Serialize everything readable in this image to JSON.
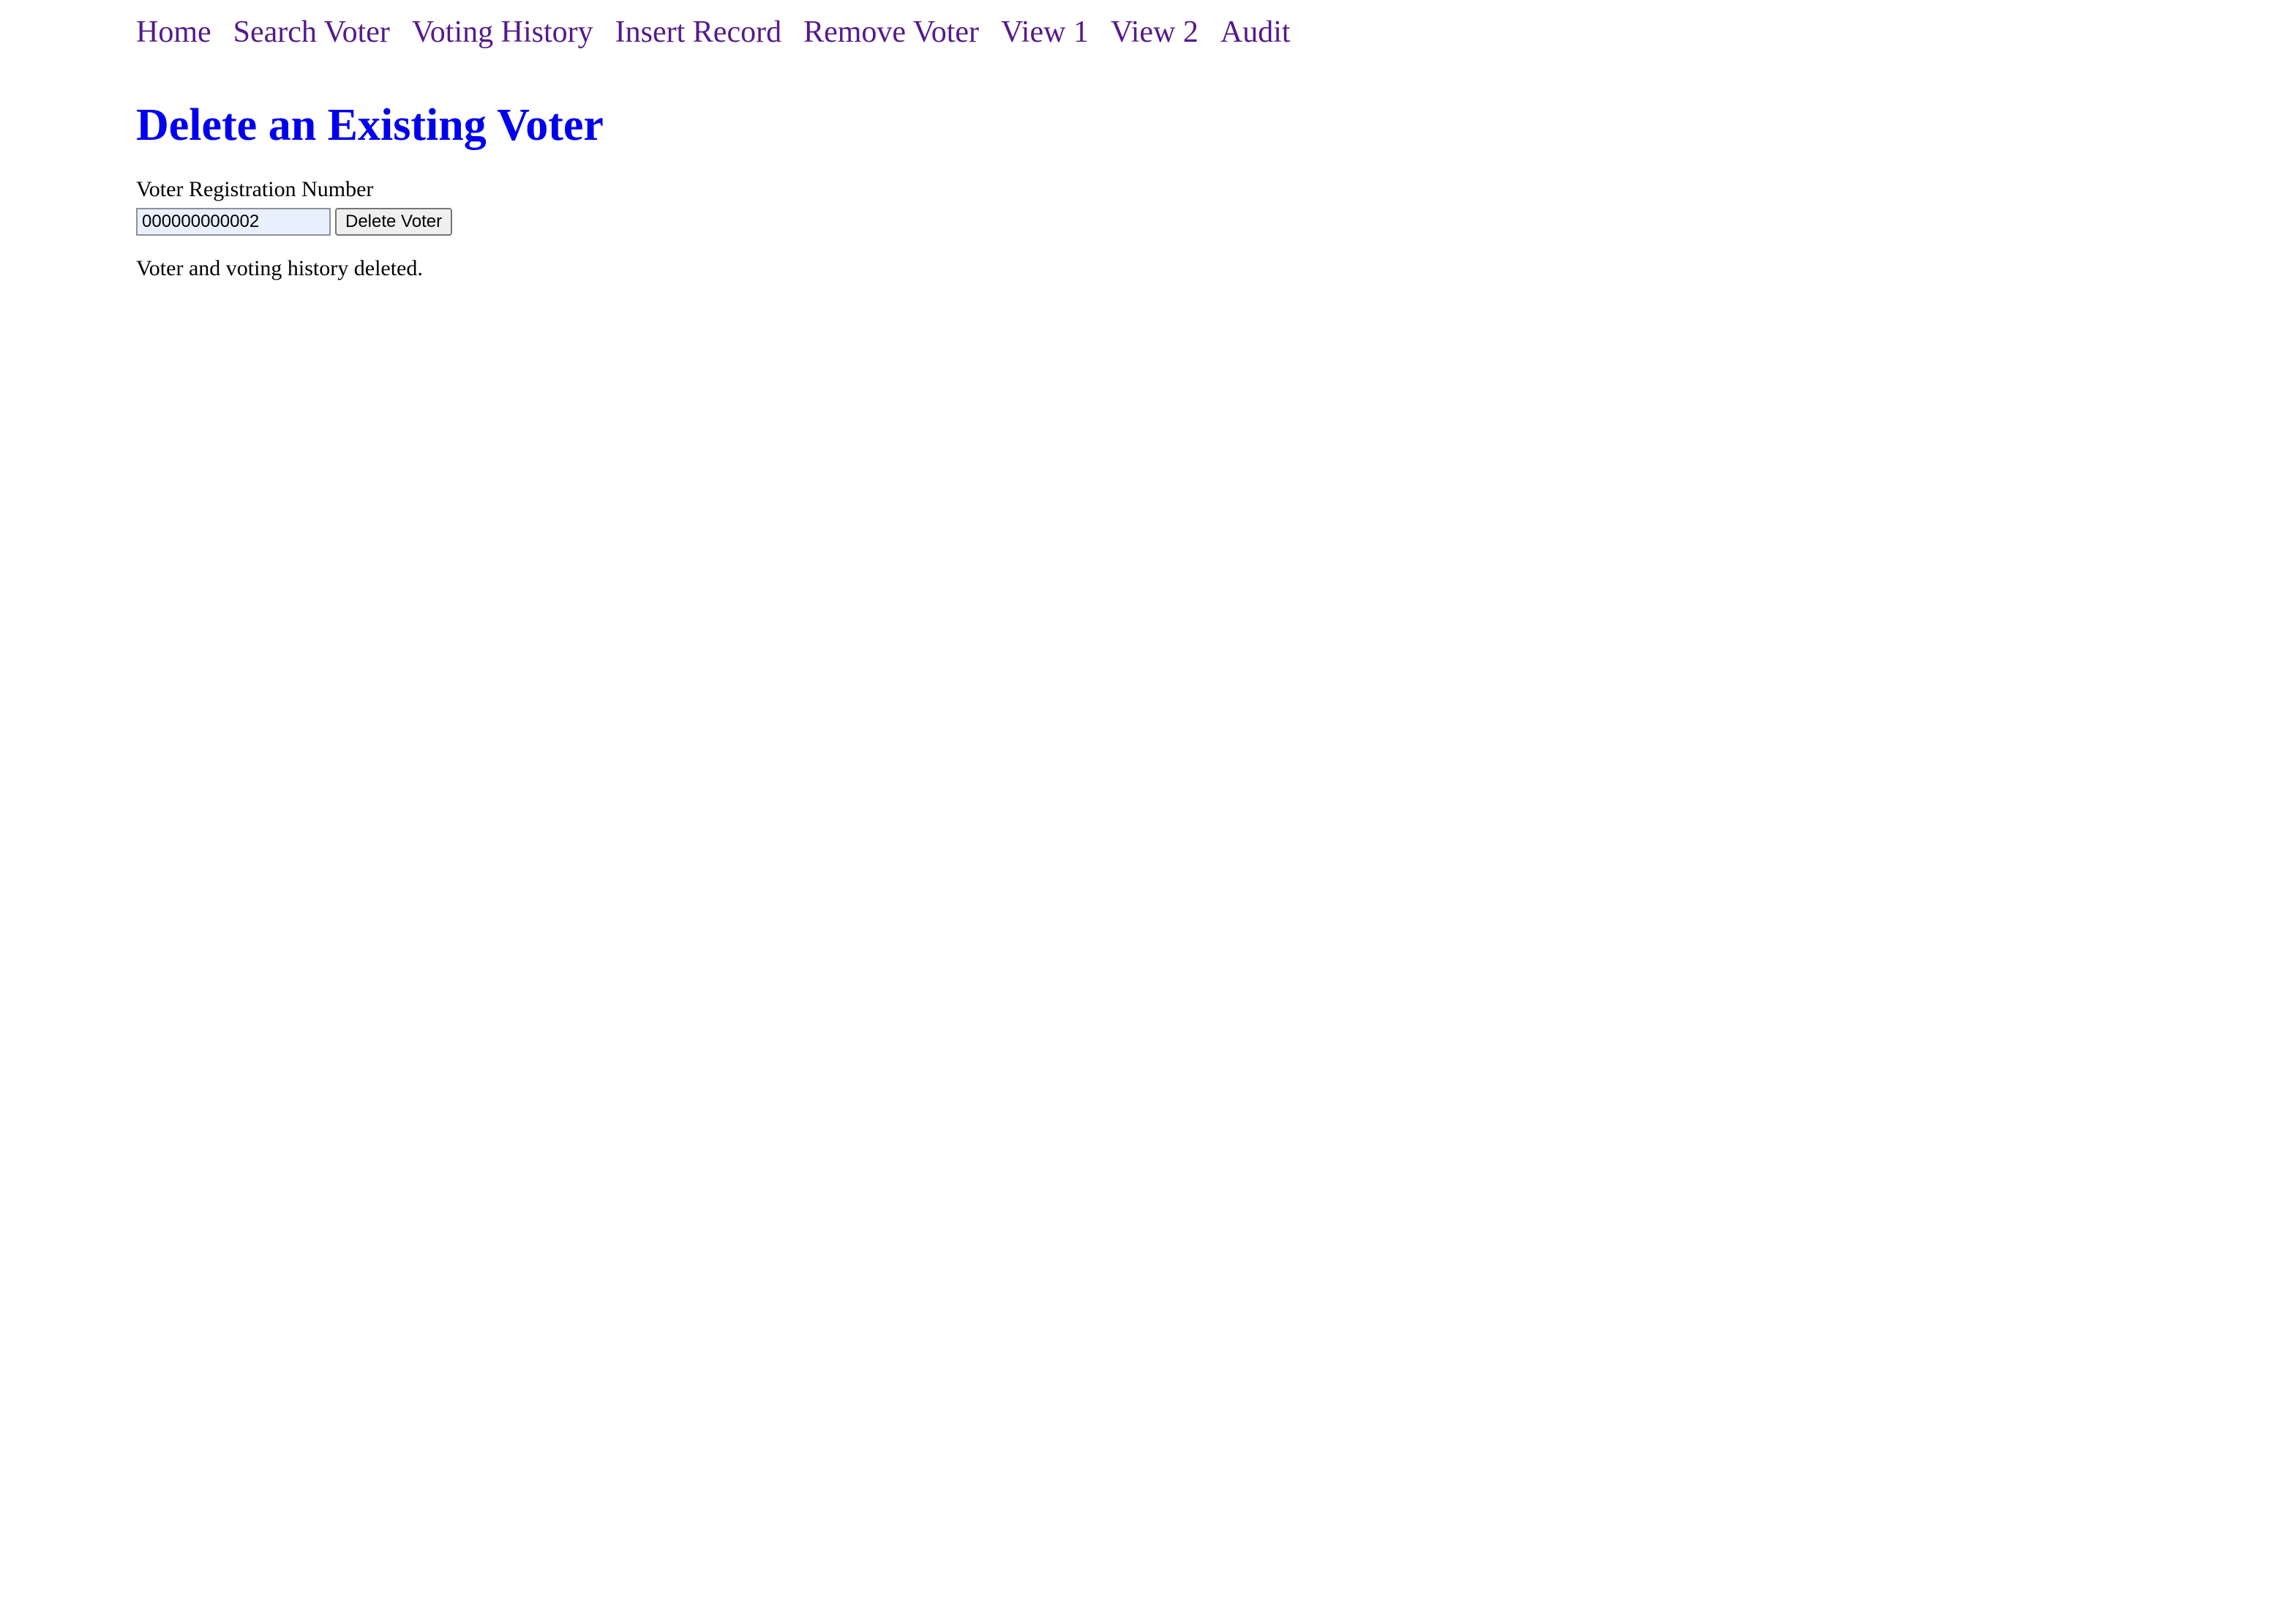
{
  "nav": {
    "items": [
      {
        "label": "Home"
      },
      {
        "label": "Search Voter"
      },
      {
        "label": "Voting History"
      },
      {
        "label": "Insert Record"
      },
      {
        "label": "Remove Voter"
      },
      {
        "label": "View 1"
      },
      {
        "label": "View 2"
      },
      {
        "label": "Audit"
      }
    ]
  },
  "page": {
    "title": "Delete an Existing Voter"
  },
  "form": {
    "field_label": "Voter Registration Number",
    "voter_number_value": "000000000002",
    "submit_label": "Delete Voter"
  },
  "status": {
    "message": "Voter and voting history deleted."
  },
  "colors": {
    "link_visited": "#551a8b",
    "heading": "#0000ee",
    "input_autofill_bg": "#e8f0fe"
  }
}
